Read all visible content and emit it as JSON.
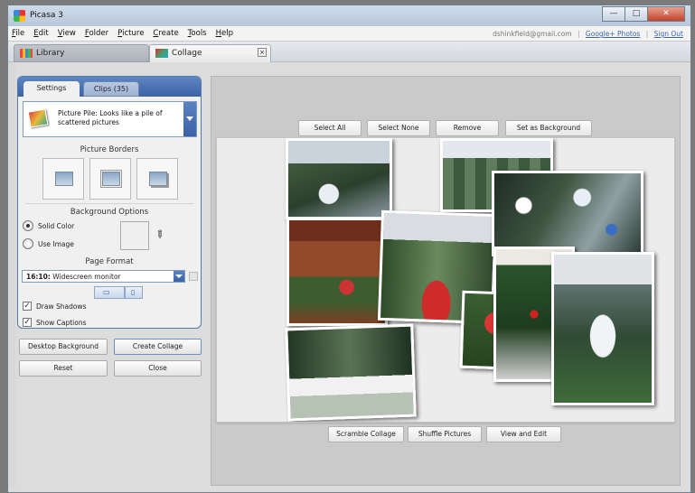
{
  "window": {
    "title": "Picasa 3"
  },
  "window_controls": {
    "minimize": "—",
    "maximize": "□",
    "close": "✕"
  },
  "menubar": {
    "items": [
      "File",
      "Edit",
      "View",
      "Folder",
      "Picture",
      "Create",
      "Tools",
      "Help"
    ],
    "account_email": "dshinkfield@gmail.com",
    "links": [
      "Google+ Photos",
      "Sign Out"
    ],
    "separator": "|"
  },
  "tabs": [
    {
      "label": "Library"
    },
    {
      "label": "Collage",
      "close": "×"
    }
  ],
  "panel": {
    "tabs": [
      "Settings",
      "Clips (35)"
    ],
    "collage_style": "Picture Pile:  Looks like a pile of scattered pictures",
    "picture_borders_title": "Picture Borders",
    "background_options_title": "Background Options",
    "solid_color_label": "Solid Color",
    "use_image_label": "Use Image",
    "page_format_title": "Page Format",
    "page_format_ratio": "16:10:",
    "page_format_name": "Widescreen monitor",
    "draw_shadows_label": "Draw Shadows",
    "show_captions_label": "Show Captions",
    "check_mark": "✓",
    "dropper_glyph": "✎"
  },
  "actions": {
    "desktop_background": "Desktop Background",
    "create_collage": "Create Collage",
    "reset": "Reset",
    "close": "Close"
  },
  "top_toolbar": [
    "Select All",
    "Select None",
    "Remove",
    "Set as Background"
  ],
  "bottom_toolbar": [
    "Scramble Collage",
    "Shuffle Pictures",
    "View and Edit"
  ],
  "colors": {
    "accent_blue": "#4a70b0",
    "link_blue": "#3a62b8",
    "workarea_gray": "#cacaca"
  }
}
